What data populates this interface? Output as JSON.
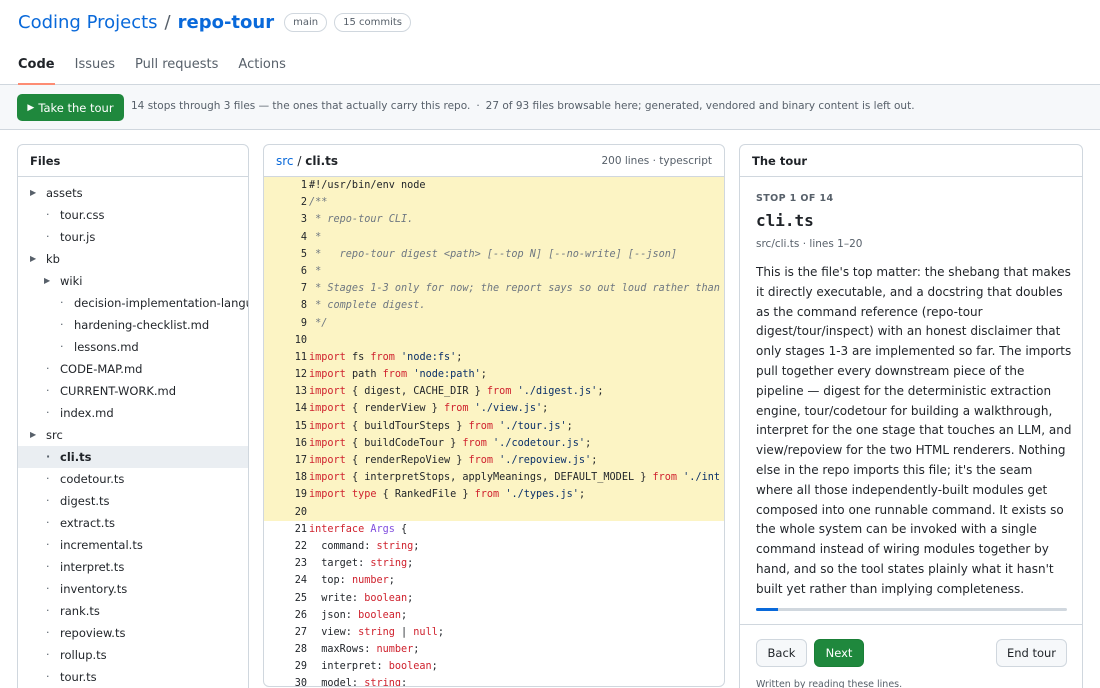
{
  "header": {
    "owner": "Coding Projects",
    "separator": "/",
    "repo": "repo-tour",
    "branch": "main",
    "commits": "15 commits"
  },
  "tabs": [
    {
      "label": "Code",
      "active": true
    },
    {
      "label": "Issues",
      "active": false
    },
    {
      "label": "Pull requests",
      "active": false
    },
    {
      "label": "Actions",
      "active": false
    }
  ],
  "banner": {
    "button_icon": "play-icon",
    "button_glyph": "▶",
    "button_label": "Take the tour",
    "summary": "14 stops through 3 files — the ones that actually carry this repo.",
    "separator": "·",
    "browsable": "27 of 93 files browsable here; generated, vendored and binary content is left out."
  },
  "files": {
    "title": "Files",
    "items": [
      {
        "label": "assets",
        "type": "folder",
        "depth": 0
      },
      {
        "label": "tour.css",
        "type": "file",
        "depth": 1
      },
      {
        "label": "tour.js",
        "type": "file",
        "depth": 1
      },
      {
        "label": "kb",
        "type": "folder",
        "depth": 0
      },
      {
        "label": "wiki",
        "type": "folder",
        "depth": 1
      },
      {
        "label": "decision-implementation-languag",
        "type": "file",
        "depth": 2
      },
      {
        "label": "hardening-checklist.md",
        "type": "file",
        "depth": 2
      },
      {
        "label": "lessons.md",
        "type": "file",
        "depth": 2
      },
      {
        "label": "CODE-MAP.md",
        "type": "file",
        "depth": 1
      },
      {
        "label": "CURRENT-WORK.md",
        "type": "file",
        "depth": 1
      },
      {
        "label": "index.md",
        "type": "file",
        "depth": 1
      },
      {
        "label": "src",
        "type": "folder",
        "depth": 0
      },
      {
        "label": "cli.ts",
        "type": "file",
        "depth": 1,
        "active": true
      },
      {
        "label": "codetour.ts",
        "type": "file",
        "depth": 1
      },
      {
        "label": "digest.ts",
        "type": "file",
        "depth": 1
      },
      {
        "label": "extract.ts",
        "type": "file",
        "depth": 1
      },
      {
        "label": "incremental.ts",
        "type": "file",
        "depth": 1
      },
      {
        "label": "interpret.ts",
        "type": "file",
        "depth": 1
      },
      {
        "label": "inventory.ts",
        "type": "file",
        "depth": 1
      },
      {
        "label": "rank.ts",
        "type": "file",
        "depth": 1
      },
      {
        "label": "repoview.ts",
        "type": "file",
        "depth": 1
      },
      {
        "label": "rollup.ts",
        "type": "file",
        "depth": 1
      },
      {
        "label": "tour.ts",
        "type": "file",
        "depth": 1
      }
    ]
  },
  "code": {
    "dir": "src",
    "path_separator": "/",
    "file": "cli.ts",
    "meta": "200 lines · typescript",
    "highlight_range": [
      1,
      20
    ],
    "lines": [
      {
        "n": "1",
        "text": "#!/usr/bin/env node"
      },
      {
        "n": "2",
        "text": "/**"
      },
      {
        "n": "3",
        "text": " * repo-tour CLI."
      },
      {
        "n": "4",
        "text": " *"
      },
      {
        "n": "5",
        "text": " *   repo-tour digest <path> [--top N] [--no-write] [--json]"
      },
      {
        "n": "6",
        "text": " *"
      },
      {
        "n": "7",
        "text": " * Stages 1-3 only for now; the report says so out loud rather than"
      },
      {
        "n": "8",
        "text": " * complete digest."
      },
      {
        "n": "9",
        "text": " */"
      },
      {
        "n": "10",
        "text": ""
      },
      {
        "n": "11",
        "text": "import fs from 'node:fs';"
      },
      {
        "n": "12",
        "text": "import path from 'node:path';"
      },
      {
        "n": "13",
        "text": "import { digest, CACHE_DIR } from './digest.js';"
      },
      {
        "n": "14",
        "text": "import { renderView } from './view.js';"
      },
      {
        "n": "15",
        "text": "import { buildTourSteps } from './tour.js';"
      },
      {
        "n": "16",
        "text": "import { buildCodeTour } from './codetour.js';"
      },
      {
        "n": "17",
        "text": "import { renderRepoView } from './repoview.js';"
      },
      {
        "n": "18",
        "text": "import { interpretStops, applyMeanings, DEFAULT_MODEL } from './int"
      },
      {
        "n": "19",
        "text": "import type { RankedFile } from './types.js';"
      },
      {
        "n": "20",
        "text": ""
      },
      {
        "n": "21",
        "text": "interface Args {"
      },
      {
        "n": "22",
        "text": "  command: string;"
      },
      {
        "n": "23",
        "text": "  target: string;"
      },
      {
        "n": "24",
        "text": "  top: number;"
      },
      {
        "n": "25",
        "text": "  write: boolean;"
      },
      {
        "n": "26",
        "text": "  json: boolean;"
      },
      {
        "n": "27",
        "text": "  view: string | null;"
      },
      {
        "n": "28",
        "text": "  maxRows: number;"
      },
      {
        "n": "29",
        "text": "  interpret: boolean;"
      },
      {
        "n": "30",
        "text": "  model: string;"
      }
    ]
  },
  "tour": {
    "title": "The tour",
    "stop_label": "STOP 1 OF 14",
    "stop_title": "cli.ts",
    "stop_location": "src/cli.ts · lines 1–20",
    "description": "This is the file's top matter: the shebang that makes it directly executable, and a docstring that doubles as the command reference (repo-tour digest/tour/inspect) with an honest disclaimer that only stages 1-3 are implemented so far. The imports pull together every downstream piece of the pipeline — digest for the deterministic extraction engine, tour/codetour for building a walkthrough, interpret for the one stage that touches an LLM, and view/repoview for the two HTML renderers. Nothing else in the repo imports this file; it's the seam where all those independently-built modules get composed into one runnable command. It exists so the whole system can be invoked with a single command instead of wiring modules together by hand, and so the tool states plainly what it hasn't built yet rather than implying completeness.",
    "progress": 0.0714,
    "back_label": "Back",
    "next_label": "Next",
    "end_label": "End tour",
    "footnote": "Written by reading these lines."
  },
  "colors": {
    "accent": "#0969da",
    "primary_button": "#1f883d",
    "highlight": "#fcf4c4",
    "tab_underline": "#fd8c73"
  }
}
